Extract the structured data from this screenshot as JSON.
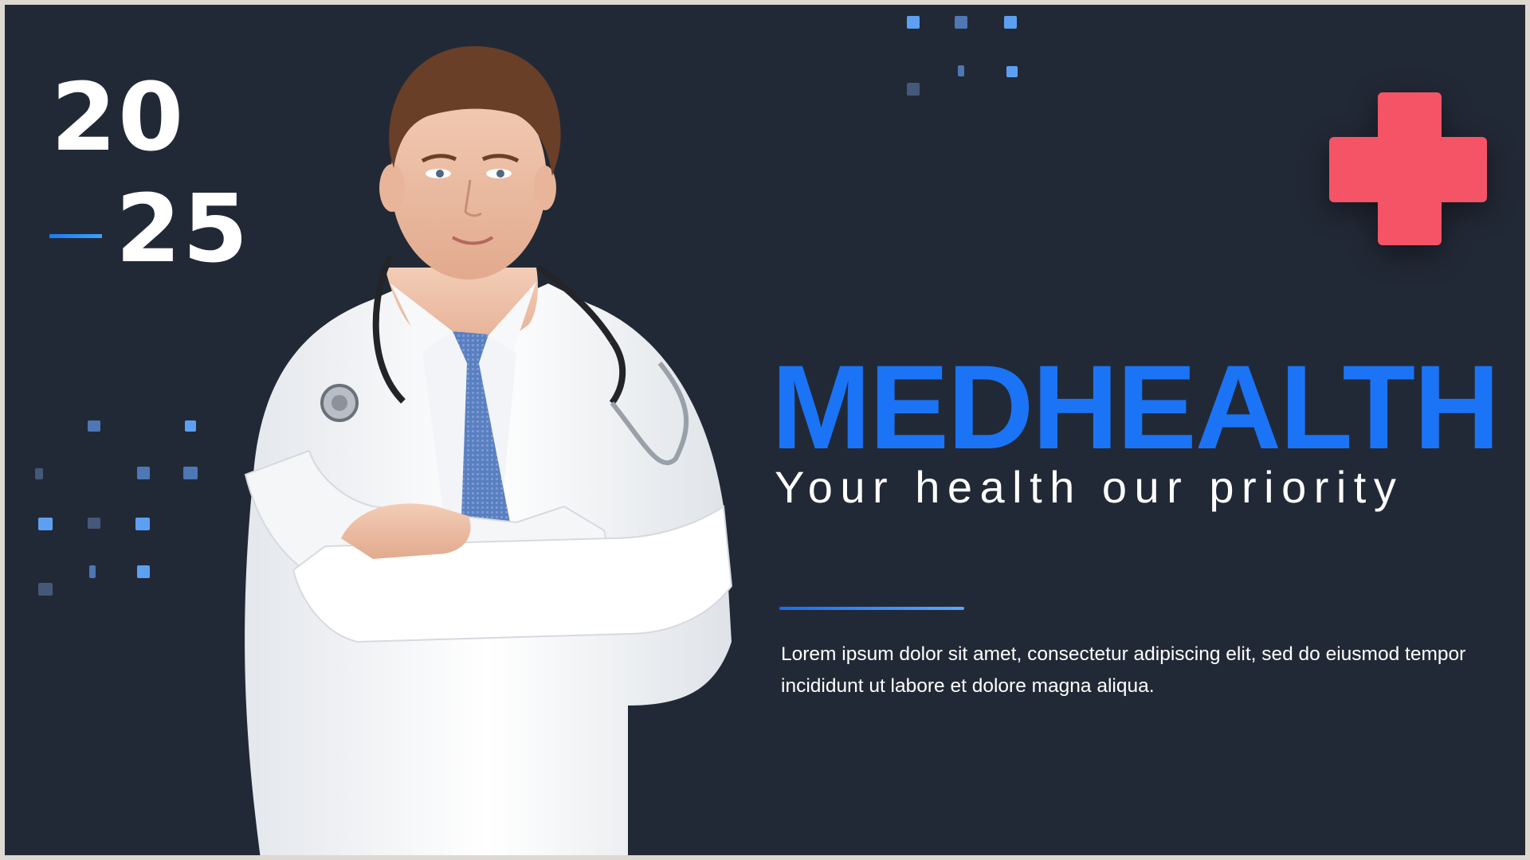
{
  "slide": {
    "year_top": "20",
    "year_bottom": "25",
    "brand": "MEDHEALTH",
    "tagline": "Your health our priority",
    "body": "Lorem ipsum dolor sit amet, consectetur  adipiscing elit, sed do eiusmod tempor incididunt ut labore et dolore magna aliqua."
  },
  "colors": {
    "background": "#222936",
    "brand_blue": "#1b74f6",
    "cross_red": "#f45466",
    "text": "#ffffff"
  },
  "icons": {
    "cross": "medical-cross-icon"
  }
}
